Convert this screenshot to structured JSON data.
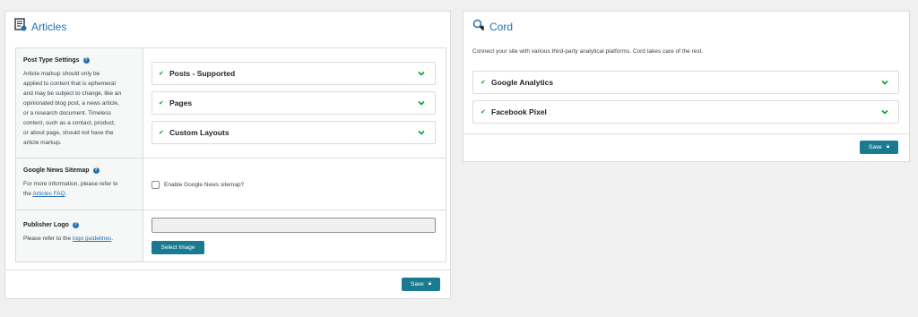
{
  "articles": {
    "title": "Articles",
    "icon": "document-list-icon",
    "post_type": {
      "title": "Post Type Settings",
      "help": "?",
      "desc_lines": [
        "Article markup should only be",
        "applied to content that is ephemeral",
        "and may be subject to change, like an",
        "opinionated blog post, a news article,",
        "or a research document. Timeless",
        "content, such as a contact, product,",
        "or about page, should not have the",
        "article markup."
      ],
      "options": [
        "Posts - Supported",
        "Pages",
        "Custom Layouts"
      ]
    },
    "news_sitemap": {
      "title": "Google News Sitemap",
      "help": "?",
      "desc_prefix": "For more information, please refer to",
      "desc_the": "the ",
      "desc_link": "Articles FAQ",
      "desc_suffix": ".",
      "checkbox_label": "Enable Google News sitemap?",
      "checked": false
    },
    "publisher_logo": {
      "title": "Publisher Logo",
      "help": "?",
      "desc_prefix": "Please refer to the ",
      "desc_link": "logo guidelines",
      "desc_suffix": ".",
      "input_value": "",
      "select_label": "Select Image"
    },
    "save_label": "Save"
  },
  "cord": {
    "title": "Cord",
    "icon": "magnifier-plus-icon",
    "intro": "Connect your site with various third-party analytical platforms. Cord takes care of the rest.",
    "options": [
      "Google Analytics",
      "Facebook Pixel"
    ],
    "save_label": "Save"
  },
  "colors": {
    "accent": "#2271b1",
    "button": "#1a7a8f",
    "check": "#00a32a"
  }
}
